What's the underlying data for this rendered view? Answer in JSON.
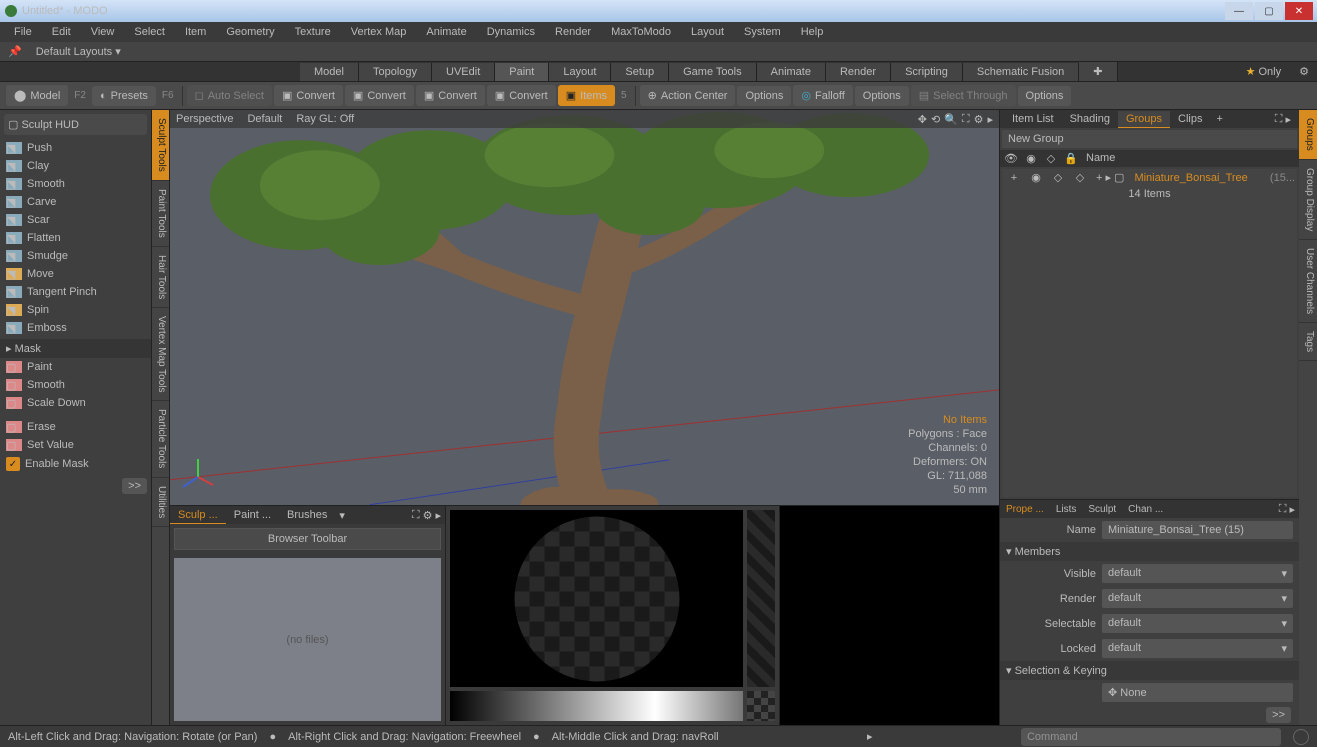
{
  "app": {
    "title": "Untitled* - MODO"
  },
  "menubar": [
    "File",
    "Edit",
    "View",
    "Select",
    "Item",
    "Geometry",
    "Texture",
    "Vertex Map",
    "Animate",
    "Dynamics",
    "Render",
    "MaxToModo",
    "Layout",
    "System",
    "Help"
  ],
  "layout": {
    "label": "Default Layouts ▾"
  },
  "workspace_tabs": [
    "Model",
    "Topology",
    "UVEdit",
    "Paint",
    "Layout",
    "Setup",
    "Game Tools",
    "Animate",
    "Render",
    "Scripting",
    "Schematic Fusion"
  ],
  "workspace_selected": "Paint",
  "only_label": "Only",
  "toolbar": {
    "model": "Model",
    "model_key": "F2",
    "presets": "Presets",
    "presets_key": "F6",
    "autoselect": "Auto Select",
    "convert": "Convert",
    "items": "Items",
    "items_key": "5",
    "action_center": "Action Center",
    "options": "Options",
    "falloff": "Falloff",
    "select_through": "Select Through"
  },
  "sculpt_hud": "Sculpt HUD",
  "sculpt_tools": [
    "Push",
    "Clay",
    "Smooth",
    "Carve",
    "Scar",
    "Flatten",
    "Smudge",
    "Move",
    "Tangent Pinch",
    "Spin",
    "Emboss"
  ],
  "mask_header": "Mask",
  "mask_tools": [
    "Paint",
    "Smooth",
    "Scale Down"
  ],
  "mask_ops": [
    "Erase",
    "Set Value"
  ],
  "enable_mask": "Enable Mask",
  "vert_tabs_left": [
    "Sculpt Tools",
    "Paint Tools",
    "Hair Tools",
    "Vertex Map Tools",
    "Particle Tools",
    "Utilities"
  ],
  "viewport": {
    "perspective": "Perspective",
    "default": "Default",
    "raygl": "Ray GL: Off",
    "info": {
      "noitems": "No Items",
      "polygons": "Polygons : Face",
      "channels": "Channels: 0",
      "deformers": "Deformers: ON",
      "gl": "GL: 711,088",
      "unit": "50 mm"
    }
  },
  "bottom_tabs": [
    "Sculp ...",
    "Paint ...",
    "Brushes"
  ],
  "browser_toolbar": "Browser Toolbar",
  "no_files": "(no files)",
  "right_tabs": [
    "Item List",
    "Shading",
    "Groups",
    "Clips"
  ],
  "right_tab_selected": "Groups",
  "new_group": "New Group",
  "group_name_hdr": "Name",
  "item": {
    "name": "Miniature_Bonsai_Tree",
    "suffix": "(15...",
    "count": "14 Items"
  },
  "props_tabs": [
    "Prope ...",
    "Lists",
    "Sculpt",
    "Chan ..."
  ],
  "props": {
    "name_label": "Name",
    "name_value": "Miniature_Bonsai_Tree (15)",
    "members": "Members",
    "visible": "Visible",
    "visible_v": "default",
    "render": "Render",
    "render_v": "default",
    "selectable": "Selectable",
    "selectable_v": "default",
    "locked": "Locked",
    "locked_v": "default",
    "selkey": "Selection & Keying",
    "none": "None"
  },
  "right_vert_tabs": [
    "Groups",
    "Group Display",
    "User Channels",
    "Tags"
  ],
  "status": {
    "s1": "Alt-Left Click and Drag: Navigation: Rotate (or Pan)",
    "s2": "Alt-Right Click and Drag: Navigation: Freewheel",
    "s3": "Alt-Middle Click and Drag: navRoll",
    "cmd_placeholder": "Command"
  }
}
